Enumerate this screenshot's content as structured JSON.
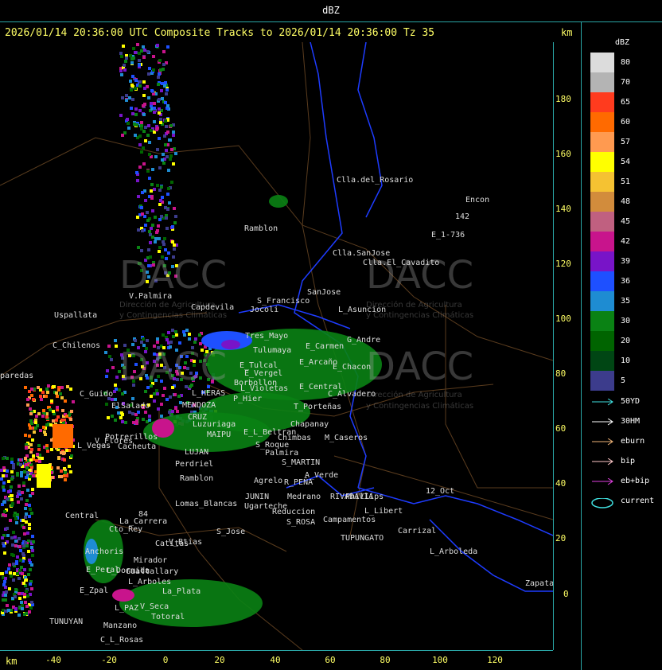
{
  "header": {
    "title": "dBZ"
  },
  "product_title": "2026/01/14 20:36:00 UTC Composite Tracks to 2026/01/14 20:36:00 Tz 35",
  "units": {
    "top_right": "km",
    "bottom_left": "km"
  },
  "y_ticks": [
    "180",
    "160",
    "140",
    "120",
    "100",
    "80",
    "60",
    "40",
    "20",
    "0"
  ],
  "x_ticks": [
    "-40",
    "-20",
    "0",
    "20",
    "40",
    "60",
    "80",
    "100",
    "120"
  ],
  "legend": {
    "title": "dBZ",
    "levels": [
      {
        "label": "80",
        "color": "#dcdcdc"
      },
      {
        "label": "70",
        "color": "#b4b4b4"
      },
      {
        "label": "65",
        "color": "#ff3b1e"
      },
      {
        "label": "60",
        "color": "#ff6a00"
      },
      {
        "label": "57",
        "color": "#ff9a50"
      },
      {
        "label": "54",
        "color": "#ffff00"
      },
      {
        "label": "51",
        "color": "#f5c232"
      },
      {
        "label": "48",
        "color": "#d28c3c"
      },
      {
        "label": "45",
        "color": "#c06080"
      },
      {
        "label": "42",
        "color": "#c8148c"
      },
      {
        "label": "39",
        "color": "#7814c8"
      },
      {
        "label": "36",
        "color": "#1e50ff"
      },
      {
        "label": "35",
        "color": "#1e8cd2"
      },
      {
        "label": "30",
        "color": "#0a8214"
      },
      {
        "label": "20",
        "color": "#006400"
      },
      {
        "label": "10",
        "color": "#004614"
      },
      {
        "label": "5",
        "color": "#3c3c8c"
      }
    ]
  },
  "tracks": [
    {
      "label": "50YD",
      "color": "#40e0e0"
    },
    {
      "label": "30HM",
      "color": "#ffffff"
    },
    {
      "label": "eburn",
      "color": "#f0b478"
    },
    {
      "label": "bip",
      "color": "#ffc8c8"
    },
    {
      "label": "eb+bip",
      "color": "#e040e0"
    },
    {
      "label": "current",
      "color": "#40e0e0"
    }
  ],
  "watermark": {
    "brand": "DACC",
    "line1": "Dirección de Agricultura",
    "line2": "y Contingencias Climáticas"
  },
  "places": [
    "Clla.del_Rosario",
    "Encon",
    "142",
    "E_1-736",
    "Ramblon",
    "Clla.SanJose",
    "Clla.El_Cavadito",
    "S_Francisco",
    "SanJose",
    "L_Asuncion",
    "Uspallata",
    "V.Palmira",
    "Capdevila",
    "Jocoli",
    "Tres_Mayo",
    "C_Chilenos",
    "Tulumaya",
    "E_Carmen",
    "G_Andre",
    "E_Arcaño",
    "E_Chacon",
    "paredas",
    "E_Tulcal",
    "E_Vergel",
    "Borbollon",
    "L_Violetas",
    "E_Central",
    "C_Alvadero",
    "C_Guido",
    "L_HERAS",
    "P_Hier",
    "T_Porteñas",
    "ElSalado",
    "MENDOZA",
    "CRUZ",
    "Luzuriaga",
    "Chapanay",
    "E_L_Beltran",
    "Chimbas",
    "M_Caseros",
    "Potrerillos",
    "L_Vegas",
    "Cacheuta",
    "MAIPU",
    "LUJAN",
    "S_Roque",
    "Palmira",
    "Perdriel",
    "S_MARTIN",
    "A_Verde",
    "Ramblon",
    "Agrelo",
    "R_PEÑA",
    "JUNIN",
    "Medrano",
    "RIVADAVIA",
    "Phillips",
    "12_Oct",
    "Lomas_Blancas",
    "Ugarteche",
    "Reduccion",
    "L_Libert",
    "S_ROSA",
    "Campamentos",
    "Central",
    "La_Carrera",
    "Cto_Rey",
    "S_Jose",
    "Carrizal",
    "Catitas",
    "V_Btias",
    "Anchoris",
    "TUPUNGATO",
    "Mirador",
    "L_Arboleda",
    "L_Dormida",
    "E_Peral",
    "Gualtallary",
    "E_Zpal",
    "L_Arboles",
    "La_Plata",
    "Zapata",
    "L_PAZ",
    "V_Seca",
    "Totoral",
    "TUNUYAN",
    "Manzano",
    "C_L_Rosas",
    "V_Flores",
    "84",
    "88"
  ]
}
